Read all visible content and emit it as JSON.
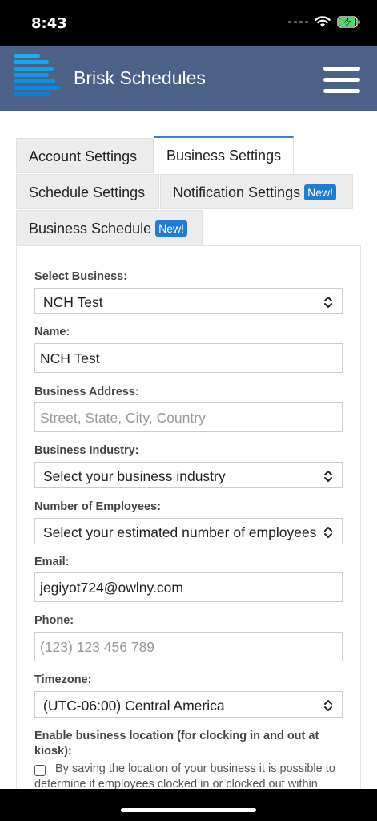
{
  "status_bar": {
    "time": "8:43"
  },
  "app": {
    "title": "Brisk Schedules",
    "header_color": "#4b6185"
  },
  "tabs": [
    {
      "label": "Account Settings",
      "active": false,
      "new": false
    },
    {
      "label": "Business Settings",
      "active": true,
      "new": false
    },
    {
      "label": "Schedule Settings",
      "active": false,
      "new": false
    },
    {
      "label": "Notification Settings",
      "active": false,
      "new": true
    },
    {
      "label": "Business Schedule",
      "active": false,
      "new": true
    }
  ],
  "badge_new": "New!",
  "form": {
    "select_business": {
      "label": "Select Business:",
      "value": "NCH Test"
    },
    "name": {
      "label": "Name:",
      "value": "NCH Test"
    },
    "business_address": {
      "label": "Business Address:",
      "placeholder": "Street, State, City, Country"
    },
    "business_industry": {
      "label": "Business Industry:",
      "value": "Select your business industry"
    },
    "number_of_employees": {
      "label": "Number of Employees:",
      "value": "Select your estimated number of employees"
    },
    "email": {
      "label": "Email:",
      "value": "jegiyot724@owlny.com"
    },
    "phone": {
      "label": "Phone:",
      "placeholder": "(123) 123 456 789"
    },
    "timezone": {
      "label": "Timezone:",
      "value": "(UTC-06:00) Central America"
    },
    "business_location": {
      "label": "Enable business location (for clocking in and out at kiosk):",
      "help": "By saving the location of your business it is possible to determine if employees clocked in or clocked out within"
    }
  }
}
